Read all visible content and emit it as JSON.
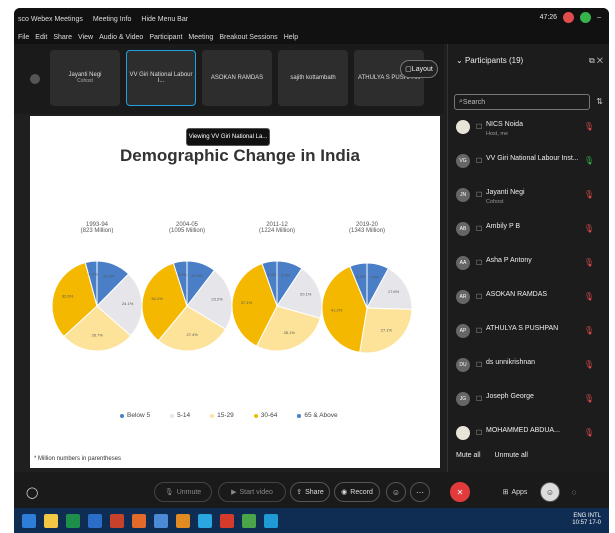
{
  "titlebar": {
    "app_title": "sco Webex Meetings",
    "meeting_info": "Meeting Info",
    "hide_menu": "Hide Menu Bar",
    "clock": "47:26"
  },
  "menu": [
    "File",
    "Edit",
    "Share",
    "View",
    "Audio & Video",
    "Participant",
    "Meeting",
    "Breakout Sessions",
    "Help"
  ],
  "video_strip": [
    {
      "name": "Jayanti Negi",
      "sub": "Cohost"
    },
    {
      "name": "VV Giri National Labour I...",
      "sub": ""
    },
    {
      "name": "ASOKAN RAMDAS",
      "sub": ""
    },
    {
      "name": "sajith kottambath",
      "sub": ""
    },
    {
      "name": "ATHULYA S PUSHPAN",
      "sub": ""
    }
  ],
  "layout_label": "Layout",
  "tooltip": "Viewing VV Giri National La...",
  "slide": {
    "title": "Demographic Change in India",
    "footnote": "* Million numbers in parentheses",
    "pies": [
      {
        "year": "1993-94",
        "pop": "(823 Million)"
      },
      {
        "year": "2004-05",
        "pop": "(1095 Million)"
      },
      {
        "year": "2011-12",
        "pop": "(1224 Million)"
      },
      {
        "year": "2019-20",
        "pop": "(1343 Million)"
      }
    ],
    "legend": [
      {
        "label": "Below 5",
        "color": "#4a7fc8"
      },
      {
        "label": "5-14",
        "color": "#e6e6ea"
      },
      {
        "label": "15-29",
        "color": "#fde39a"
      },
      {
        "label": "30-64",
        "color": "#f5b800"
      },
      {
        "label": "65 & Above",
        "color": "#4a7fc8"
      }
    ]
  },
  "chart_data": {
    "type": "pie",
    "title": "Demographic Change in India",
    "categories": [
      "Below 5",
      "5-14",
      "15-29",
      "30-64",
      "65 & Above"
    ],
    "series": [
      {
        "name": "1993-94",
        "values": [
          12.4,
          24.1,
          26.7,
          32.6,
          4.2
        ]
      },
      {
        "name": "2004-05",
        "values": [
          10.4,
          23.2,
          27.4,
          34.1,
          4.9
        ]
      },
      {
        "name": "2011-12",
        "values": [
          9.3,
          20.1,
          28.1,
          37.1,
          5.4
        ]
      },
      {
        "name": "2019-20",
        "values": [
          7.9,
          17.6,
          27.1,
          41.2,
          6.2
        ]
      }
    ]
  },
  "participants": {
    "header": "Participants (19)",
    "search_placeholder": "Search",
    "list": [
      {
        "initials": "",
        "name": "NICS Noida",
        "sub": "Host, me",
        "mic": "muted"
      },
      {
        "initials": "VG",
        "name": "VV Giri National Labour Inst...",
        "sub": "",
        "mic": "on"
      },
      {
        "initials": "JN",
        "name": "Jayanti Negi",
        "sub": "Cohost",
        "mic": "muted"
      },
      {
        "initials": "AB",
        "name": "Ambily P B",
        "sub": "",
        "mic": "muted"
      },
      {
        "initials": "AA",
        "name": "Asha P Antony",
        "sub": "",
        "mic": "muted"
      },
      {
        "initials": "AR",
        "name": "ASOKAN RAMDAS",
        "sub": "",
        "mic": "muted"
      },
      {
        "initials": "AP",
        "name": "ATHULYA S PUSHPAN",
        "sub": "",
        "mic": "muted"
      },
      {
        "initials": "DU",
        "name": "ds unnikrishnan",
        "sub": "",
        "mic": "muted"
      },
      {
        "initials": "JG",
        "name": "Joseph George",
        "sub": "",
        "mic": "muted"
      },
      {
        "initials": "",
        "name": "MOHAMMED ABDUA...",
        "sub": "",
        "mic": "muted"
      }
    ],
    "mute_all": "Mute all",
    "unmute_all": "Unmute all"
  },
  "controls": {
    "unmute": "Unmute",
    "start_video": "Start video",
    "share": "Share",
    "record": "Record",
    "apps": "Apps"
  },
  "tray": {
    "lang": "ENG INTL",
    "time": "10:57",
    "date": "17-0"
  }
}
